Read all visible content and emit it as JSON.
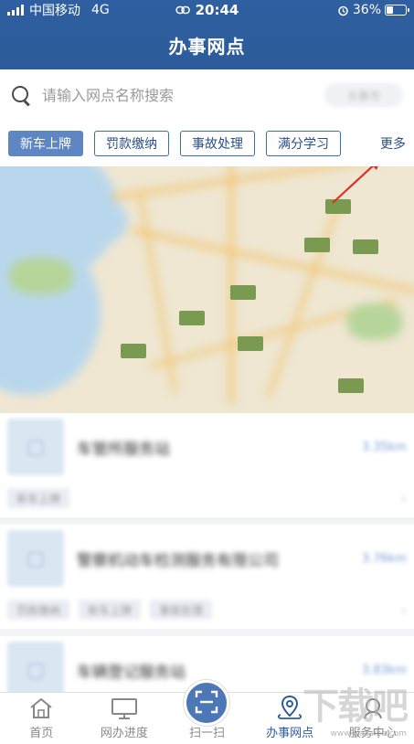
{
  "status_bar": {
    "carrier": "中国移动",
    "network": "4G",
    "time": "20:44",
    "battery": "36%",
    "battery_level": 0.36
  },
  "header": {
    "title": "办事网点"
  },
  "search": {
    "placeholder": "请输入网点名称搜索",
    "city": "长春市"
  },
  "categories": [
    {
      "label": "新车上牌",
      "active": true
    },
    {
      "label": "罚款缴纳",
      "active": false
    },
    {
      "label": "事故处理",
      "active": false
    },
    {
      "label": "满分学习",
      "active": false
    }
  ],
  "more_label": "更多",
  "list": [
    {
      "name": "车管所服务站",
      "distance": "3.35km",
      "tags": [
        "新车上牌"
      ]
    },
    {
      "name": "警察机动车检测服务有限公司",
      "distance": "3.76km",
      "tags": [
        "罚款缴纳",
        "新车上牌",
        "事故处理"
      ]
    },
    {
      "name": "车辆登记服务站",
      "distance": "3.83km",
      "tags": []
    }
  ],
  "bottom_nav": [
    {
      "label": "首页",
      "icon": "home-icon",
      "active": false
    },
    {
      "label": "网办进度",
      "icon": "monitor-icon",
      "active": false
    },
    {
      "label": "扫一扫",
      "icon": "scan-icon",
      "active": false
    },
    {
      "label": "办事网点",
      "icon": "location-icon",
      "active": true
    },
    {
      "label": "服务中心",
      "icon": "service-icon",
      "active": false
    }
  ],
  "watermark": {
    "text": "下载吧",
    "sub": "www.xiazaiba.com"
  },
  "colors": {
    "primary": "#2d5c9b",
    "accent": "#5d86c2"
  }
}
